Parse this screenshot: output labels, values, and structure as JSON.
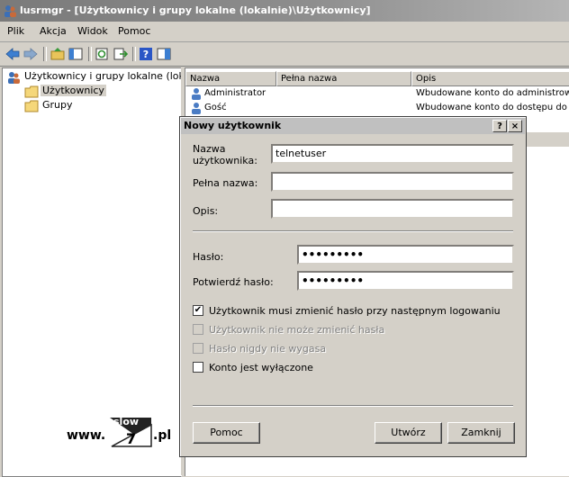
{
  "window": {
    "title": "lusrmgr - [Użytkownicy i grupy lokalne (lokalnie)\\Użytkownicy]"
  },
  "menu": [
    "Plik",
    "Akcja",
    "Widok",
    "Pomoc"
  ],
  "tree": {
    "root": "Użytkownicy i grupy lokalne (lokalni",
    "children": [
      "Użytkownicy",
      "Grupy"
    ]
  },
  "list": {
    "columns": [
      "Nazwa",
      "Pełna nazwa",
      "Opis"
    ],
    "rows": [
      {
        "name": "Administrator",
        "full": "",
        "desc": "Wbudowane konto do administrowa"
      },
      {
        "name": "Gość",
        "full": "",
        "desc": "Wbudowane konto do dostępu do k"
      }
    ]
  },
  "dialog": {
    "title": "Nowy użytkownik",
    "help_glyph": "?",
    "close_glyph": "×",
    "username_label": "Nazwa\nużytkownika:",
    "username_value": "telnetuser",
    "fullname_label": "Pełna nazwa:",
    "fullname_value": "",
    "desc_label": "Opis:",
    "desc_value": "",
    "password_label": "Hasło:",
    "password_value": "•••••••••",
    "confirm_label": "Potwierdź hasło:",
    "confirm_value": "•••••••••",
    "checkboxes": [
      {
        "label": "Użytkownik musi zmienić hasło przy następnym logowaniu",
        "checked": true,
        "enabled": true
      },
      {
        "label": "Użytkownik nie może zmienić hasła",
        "checked": false,
        "enabled": false
      },
      {
        "label": "Hasło nigdy nie wygasa",
        "checked": false,
        "enabled": false
      },
      {
        "label": "Konto jest wyłączone",
        "checked": false,
        "enabled": true
      }
    ],
    "btn_help": "Pomoc",
    "btn_create": "Utwórz",
    "btn_close": "Zamknij"
  },
  "watermark": {
    "prefix": "www.",
    "top": "slow",
    "digit": "7",
    "suffix": ".pl"
  }
}
